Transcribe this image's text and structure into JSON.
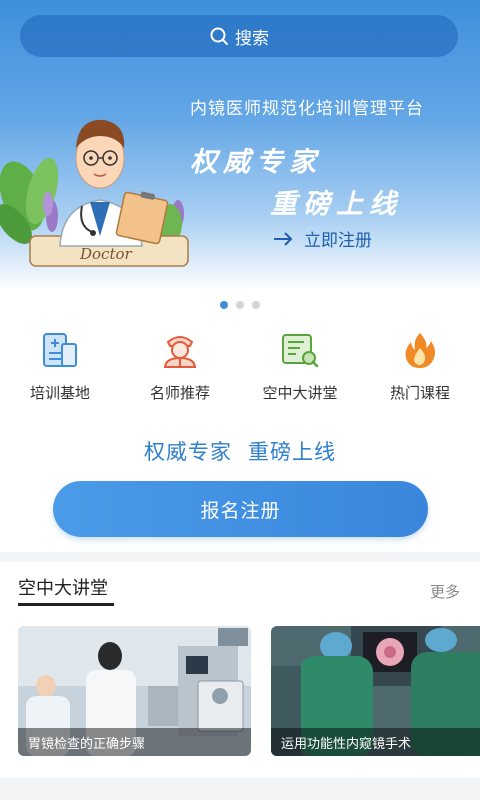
{
  "search": {
    "label": "搜索",
    "icon": "search-icon"
  },
  "banner": {
    "platform_title": "内镜医师规范化培训管理平台",
    "headline_1": "权威专家",
    "headline_2": "重磅上线",
    "cta_label": "立即注册",
    "doctor_badge": "Doctor",
    "active_slide": 1,
    "slide_count": 3
  },
  "menu": {
    "items": [
      {
        "label": "培训基地",
        "icon": "training-base-icon"
      },
      {
        "label": "名师推荐",
        "icon": "teacher-icon"
      },
      {
        "label": "空中大讲堂",
        "icon": "lecture-icon"
      },
      {
        "label": "热门课程",
        "icon": "fire-icon"
      }
    ]
  },
  "slogan": {
    "part1": "权威专家",
    "part2": "重磅上线"
  },
  "register_button": "报名注册",
  "lecture_section": {
    "title": "空中大讲堂",
    "more": "更多",
    "cards": [
      {
        "caption": "胃镜检查的正确步骤"
      },
      {
        "caption": "运用功能性内窥镜手术"
      }
    ]
  },
  "colors": {
    "primary": "#3a86dc",
    "accent_text": "#2f7fd0",
    "menu_icon_blue": "#3d8ed8",
    "menu_icon_red": "#e25b3a",
    "menu_icon_green": "#5aa43c",
    "menu_icon_orange": "#f08a24"
  }
}
